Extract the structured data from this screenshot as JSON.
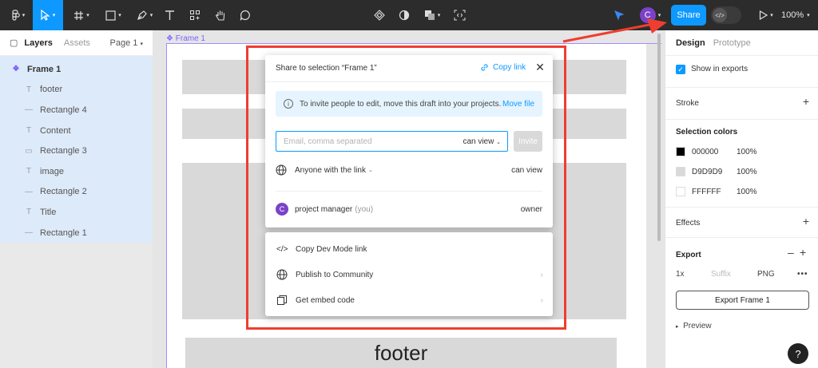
{
  "toolbar": {
    "share_label": "Share",
    "avatar_initial": "C",
    "zoom": "100%",
    "accent_color": "#0d99ff"
  },
  "left_panel": {
    "tabs": [
      "Layers",
      "Assets"
    ],
    "page_selector": "Page 1",
    "frame_name": "Frame 1",
    "layers": [
      {
        "name": "footer",
        "icon": "text-icon"
      },
      {
        "name": "Rectangle 4",
        "icon": "line-icon"
      },
      {
        "name": "Content",
        "icon": "text-icon"
      },
      {
        "name": "Rectangle 3",
        "icon": "rect-icon"
      },
      {
        "name": "image",
        "icon": "text-icon"
      },
      {
        "name": "Rectangle 2",
        "icon": "line-icon"
      },
      {
        "name": "Title",
        "icon": "text-icon"
      },
      {
        "name": "Rectangle 1",
        "icon": "line-icon"
      }
    ]
  },
  "canvas": {
    "frame_label": "Frame 1",
    "footer_text": "footer"
  },
  "share_dialog": {
    "title": "Share to selection “Frame 1”",
    "copy_link": "Copy link",
    "info_message": "To invite people to edit, move this draft into your projects.",
    "move_file": "Move file",
    "email_placeholder": "Email, comma separated",
    "email_permission": "can view",
    "invite_label": "Invite",
    "anyone_label": "Anyone with the link",
    "anyone_permission": "can view",
    "member_initial": "C",
    "member_name": "project manager",
    "member_you": "(you)",
    "member_role": "owner"
  },
  "share_options": {
    "copy_dev_mode": "Copy Dev Mode link",
    "publish_community": "Publish to Community",
    "embed_code": "Get embed code"
  },
  "right_panel": {
    "tabs": [
      "Design",
      "Prototype"
    ],
    "show_in_exports": "Show in exports",
    "stroke": "Stroke",
    "selection_colors": "Selection colors",
    "colors": [
      {
        "hex": "000000",
        "swatch": "#000000",
        "opacity": "100%"
      },
      {
        "hex": "D9D9D9",
        "swatch": "#D9D9D9",
        "opacity": "100%"
      },
      {
        "hex": "FFFFFF",
        "swatch": "#FFFFFF",
        "opacity": "100%"
      }
    ],
    "effects": "Effects",
    "export": "Export",
    "export_scale": "1x",
    "export_suffix_placeholder": "Suffix",
    "export_format": "PNG",
    "export_button": "Export Frame 1",
    "preview": "Preview"
  },
  "help": "?"
}
